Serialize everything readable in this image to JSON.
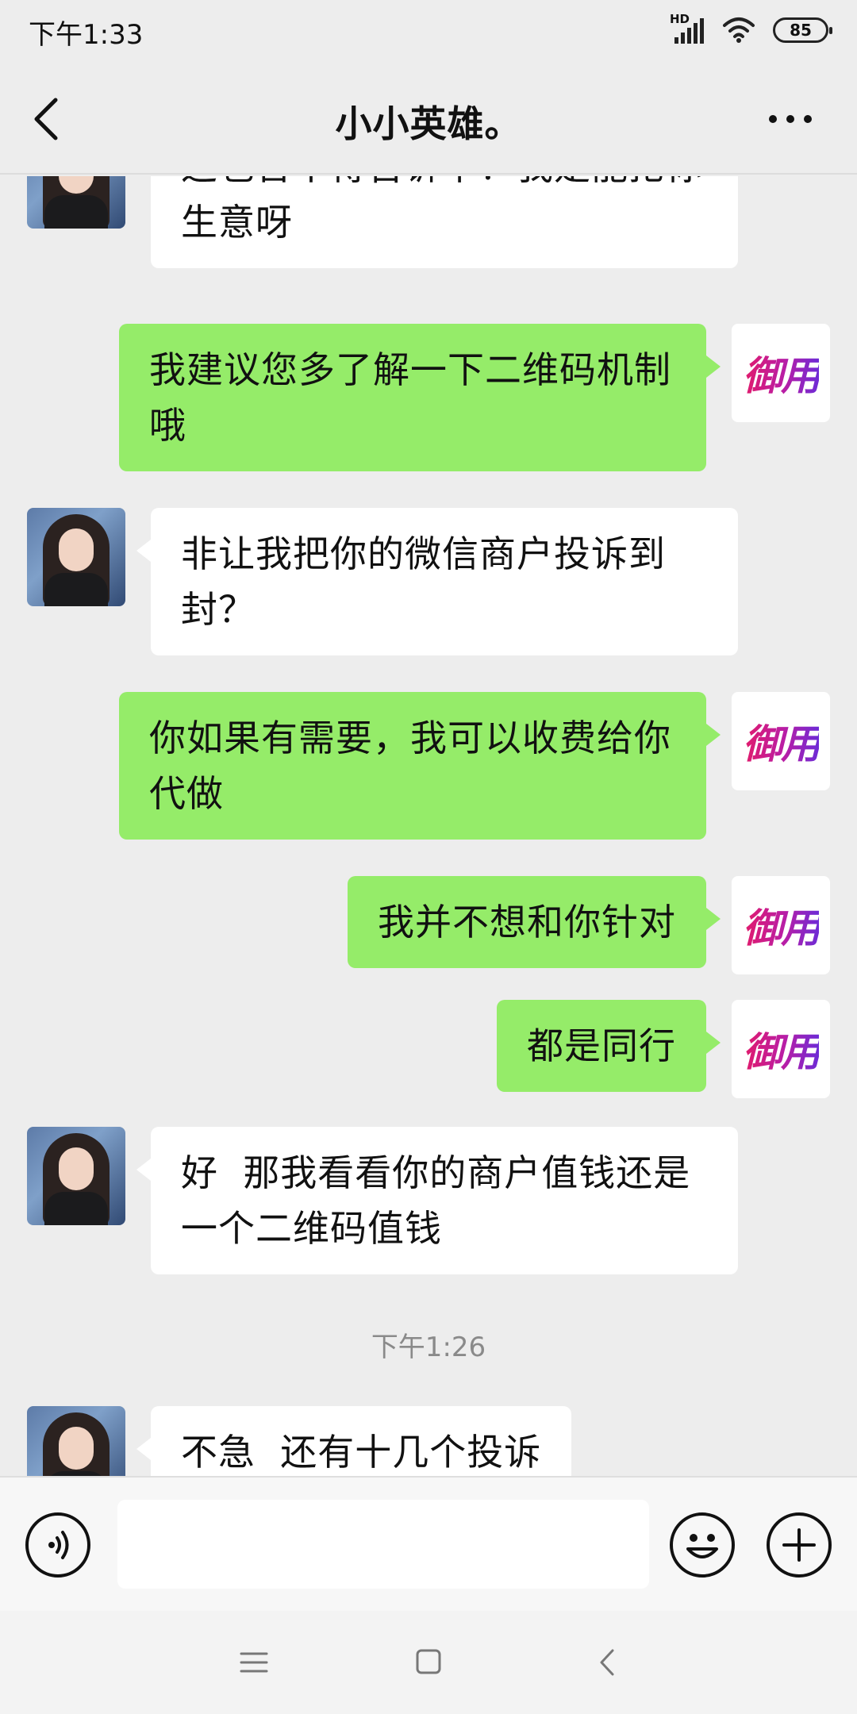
{
  "status_bar": {
    "time": "下午1:33",
    "network": "HD",
    "battery": "85",
    "signal_icon": "cell-signal-icon",
    "wifi_icon": "wifi-icon"
  },
  "header": {
    "title": "小小英雄。",
    "back_icon": "back-chevron-icon",
    "more_icon": "more-dots-icon"
  },
  "contact_avatar_icon": "contact-avatar-icon",
  "self_avatar": {
    "text": "御用",
    "gradient": [
      "#e21b6b",
      "#b81ea6",
      "#6d2bd6"
    ]
  },
  "messages": [
    {
      "side": "in",
      "text": "这也舍不得告诉下？我是能抢你生意呀"
    },
    {
      "side": "out",
      "text": "我建议您多了解一下二维码机制哦"
    },
    {
      "side": "in",
      "text": "非让我把你的微信商户投诉到封？"
    },
    {
      "side": "out",
      "text": "你如果有需要，我可以收费给你代做"
    },
    {
      "side": "out",
      "text": "我并不想和你针对"
    },
    {
      "side": "out",
      "text": "都是同行"
    },
    {
      "side": "in",
      "text": "好  那我看看你的商户值钱还是一个二维码值钱"
    },
    {
      "side": "time",
      "text": "下午1:26"
    },
    {
      "side": "in",
      "text": "不急  还有十几个投诉"
    }
  ],
  "input_bar": {
    "placeholder": "",
    "voice_icon": "voice-icon",
    "emoji_icon": "emoji-icon",
    "plus_icon": "plus-icon"
  },
  "nav_bar": {
    "icons": [
      "menu-icon",
      "home-square-icon",
      "back-triangle-icon"
    ]
  },
  "colors": {
    "background": "#ededed",
    "bubble_in": "#ffffff",
    "bubble_out": "#95ec69"
  }
}
